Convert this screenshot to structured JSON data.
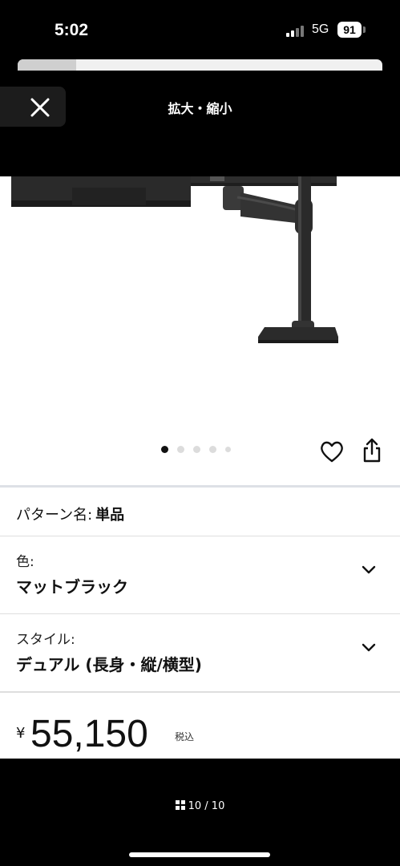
{
  "status_bar": {
    "time": "5:02",
    "network": "5G",
    "battery": "91"
  },
  "viewer": {
    "title": "拡大・縮小",
    "progress_fraction": 0.16
  },
  "gallery": {
    "dot_count": 5,
    "active_dot": 0,
    "page_indicator": "10 / 10"
  },
  "pattern": {
    "label": "パターン名:",
    "value": "単品"
  },
  "color_option": {
    "label": "色:",
    "value": "マットブラック"
  },
  "style_option": {
    "label": "スタイル:",
    "value": "デュアル (長身・縦/横型)"
  },
  "price": {
    "currency": "¥",
    "amount": "55,150",
    "tax_note": "税込"
  }
}
